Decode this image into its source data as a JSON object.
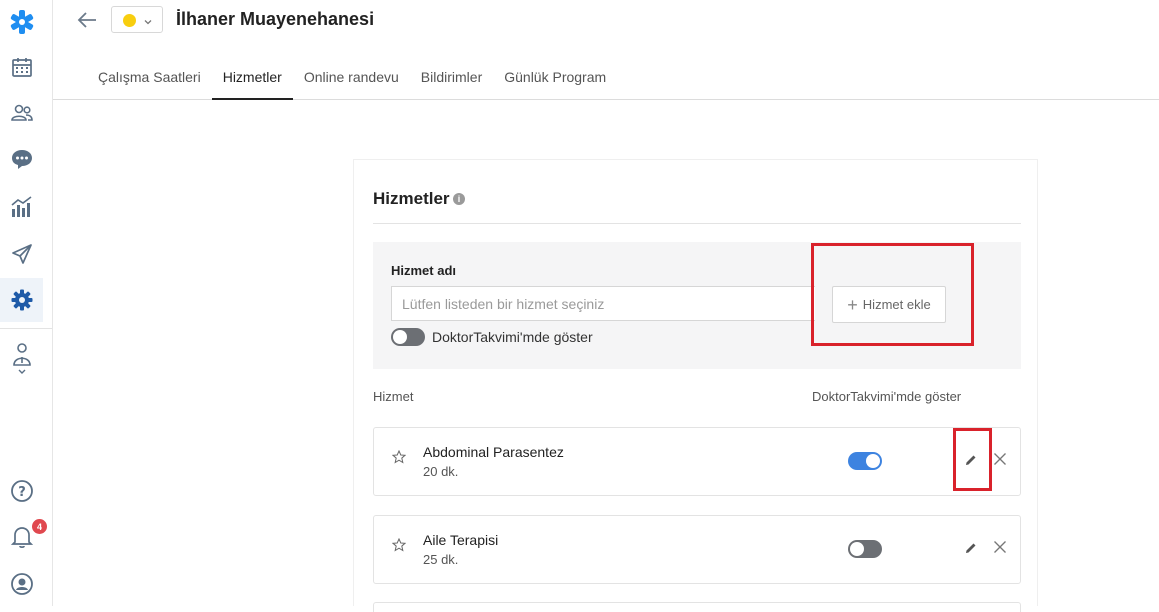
{
  "sidebar": {
    "items": [
      {
        "icon": "logo-icon"
      },
      {
        "icon": "calendar-icon"
      },
      {
        "icon": "users-icon"
      },
      {
        "icon": "chat-icon"
      },
      {
        "icon": "stats-icon"
      },
      {
        "icon": "send-icon"
      },
      {
        "icon": "gear-icon",
        "active": true
      },
      {
        "icon": "doctor-icon"
      }
    ],
    "bottom": [
      {
        "icon": "help-icon"
      },
      {
        "icon": "bell-icon",
        "badge": "4"
      },
      {
        "icon": "profile-icon"
      }
    ]
  },
  "header": {
    "status_color": "#f8ce0f",
    "clinic_name": "İlhaner Muayenehanesi",
    "tabs": [
      {
        "label": "Çalışma Saatleri"
      },
      {
        "label": "Hizmetler",
        "active": true
      },
      {
        "label": "Online randevu"
      },
      {
        "label": "Bildirimler"
      },
      {
        "label": "Günlük Program"
      }
    ]
  },
  "services": {
    "title": "Hizmetler",
    "info_glyph": "i",
    "form": {
      "label": "Hizmet adı",
      "placeholder": "Lütfen listeden bir hizmet seçiniz",
      "add_button": "Hizmet ekle",
      "toggle_label": "DoktorTakvimi'mde göster",
      "toggle_on": false
    },
    "columns": {
      "service": "Hizmet",
      "show": "DoktorTakvimi'mde göster"
    },
    "rows": [
      {
        "name": "Abdominal Parasentez",
        "duration": "20 dk.",
        "shown": true
      },
      {
        "name": "Aile Terapisi",
        "duration": "25 dk.",
        "shown": false
      }
    ]
  },
  "colors": {
    "accent_blue": "#3d83e0",
    "highlight_red": "#d9222b",
    "badge_red": "#e0484f",
    "logo_blue": "#1f8ef1"
  }
}
